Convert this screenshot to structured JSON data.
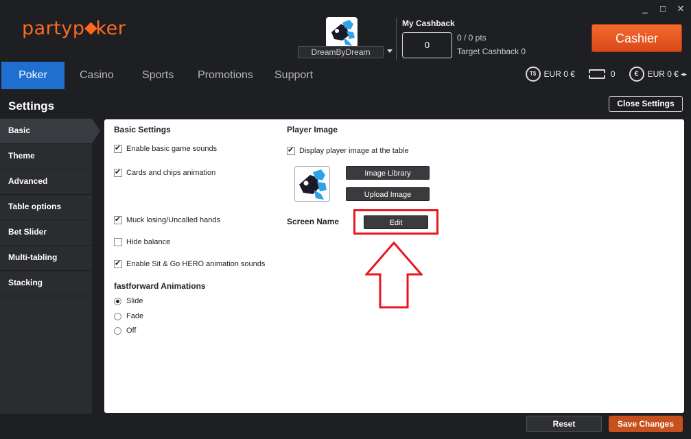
{
  "app": {
    "logo_part1": "party",
    "logo_part2": "ker",
    "brand_color": "#ff6a20"
  },
  "window_controls": {
    "minimize": "_",
    "maximize": "□",
    "close": "✕"
  },
  "header": {
    "screen_name": "DreamByDream",
    "cashback_title": "My Cashback",
    "cashback_value": "0",
    "cashback_pts": "0 / 0 pts",
    "cashback_target": "Target Cashback 0",
    "cashier_label": "Cashier"
  },
  "nav": {
    "tabs": [
      {
        "label": "Poker",
        "active": true
      },
      {
        "label": "Casino"
      },
      {
        "label": "Sports"
      },
      {
        "label": "Promotions"
      },
      {
        "label": "Support"
      }
    ],
    "active_color": "#1f6fd1"
  },
  "balances": {
    "tournament_dollars_icon": "T$",
    "tournament_dollars": "EUR 0 €",
    "tickets": "0",
    "cash_icon": "€",
    "cash": "EUR 0 €",
    "toggle_icon": "◂▸"
  },
  "settings": {
    "title": "Settings",
    "close_label": "Close Settings",
    "sidebar": [
      {
        "label": "Basic",
        "active": true
      },
      {
        "label": "Theme"
      },
      {
        "label": "Advanced"
      },
      {
        "label": "Table options"
      },
      {
        "label": "Bet Slider"
      },
      {
        "label": "Multi-tabling"
      },
      {
        "label": "Stacking"
      }
    ],
    "basic": {
      "heading": "Basic Settings",
      "options": [
        {
          "label": "Enable basic game sounds",
          "checked": true
        },
        {
          "label": "Cards and chips animation",
          "checked": true
        },
        {
          "label": "Muck losing/Uncalled hands",
          "checked": true
        },
        {
          "label": "Hide balance",
          "checked": false
        },
        {
          "label": "Enable Sit & Go HERO animation sounds",
          "checked": true
        }
      ],
      "ff_heading": "fastforward Animations",
      "ff_options": [
        {
          "label": "Slide",
          "selected": true
        },
        {
          "label": "Fade",
          "selected": false
        },
        {
          "label": "Off",
          "selected": false
        }
      ]
    },
    "player_image": {
      "heading": "Player Image",
      "display_label": "Display player image at the table",
      "display_checked": true,
      "library_label": "Image Library",
      "upload_label": "Upload Image"
    },
    "screen_name": {
      "label": "Screen Name",
      "edit_label": "Edit"
    },
    "annotation_color": "#e8161e"
  },
  "footer": {
    "reset_label": "Reset",
    "save_label": "Save Changes"
  }
}
